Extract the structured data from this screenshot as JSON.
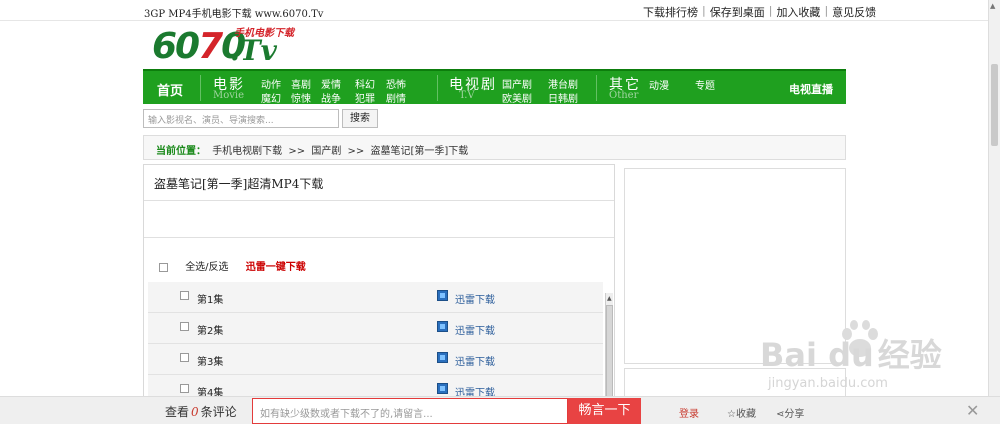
{
  "topbar": {
    "site_tag": "3GP MP4手机电影下载 www.6070.Tv",
    "links": [
      "下载排行榜",
      "保存到桌面",
      "加入收藏",
      "意见反馈"
    ]
  },
  "logo": {
    "number_a": "60",
    "number_o": "7",
    "number_b": "0",
    "tv": ".Tv",
    "slogan": "手机电影下载"
  },
  "nav": {
    "home": "首页",
    "movie": {
      "title": "电影",
      "en": "Movie",
      "items": [
        "动作",
        "喜剧",
        "爱情",
        "科幻",
        "恐怖",
        "魔幻",
        "惊悚",
        "战争",
        "犯罪",
        "剧情"
      ]
    },
    "tv": {
      "title": "电视剧",
      "en": "T.V",
      "items": [
        "国产剧",
        "港台剧",
        "欧美剧",
        "日韩剧"
      ]
    },
    "other": {
      "title": "其它",
      "en": "Other",
      "items": [
        "动漫",
        "专题"
      ]
    },
    "live": "电视直播"
  },
  "search": {
    "placeholder": "输入影视名、演员、导演搜索...",
    "button": "搜索"
  },
  "breadcrumb": {
    "current_label": "当前位置：",
    "items": [
      "手机电视剧下载",
      ">>",
      "国产剧",
      ">>",
      "盗墓笔记[第一季]下载"
    ]
  },
  "main": {
    "title": "盗墓笔记[第一季]超清MP4下载",
    "select_all": "全选/反选",
    "thunder_one_click": "迅雷一键下载",
    "episodes": [
      {
        "name": "第1集",
        "download": "迅雷下载"
      },
      {
        "name": "第2集",
        "download": "迅雷下载"
      },
      {
        "name": "第3集",
        "download": "迅雷下载"
      },
      {
        "name": "第4集",
        "download": "迅雷下载"
      }
    ]
  },
  "watermark": {
    "brand": "Bai  du",
    "cn": "经验",
    "url": "jingyan.baidu.com"
  },
  "comment_bar": {
    "see_prefix": "查看",
    "count": "0",
    "see_suffix": "条评论",
    "placeholder": "如有缺少级数或者下载不了的,请留言...",
    "submit": "畅言一下",
    "login": "登录",
    "favorite": "☆收藏",
    "share": "分享",
    "close": "✕"
  },
  "colors": {
    "nav_green": "#1fa01f",
    "logo_green": "#1b7a2f",
    "accent_red": "#e84343"
  }
}
